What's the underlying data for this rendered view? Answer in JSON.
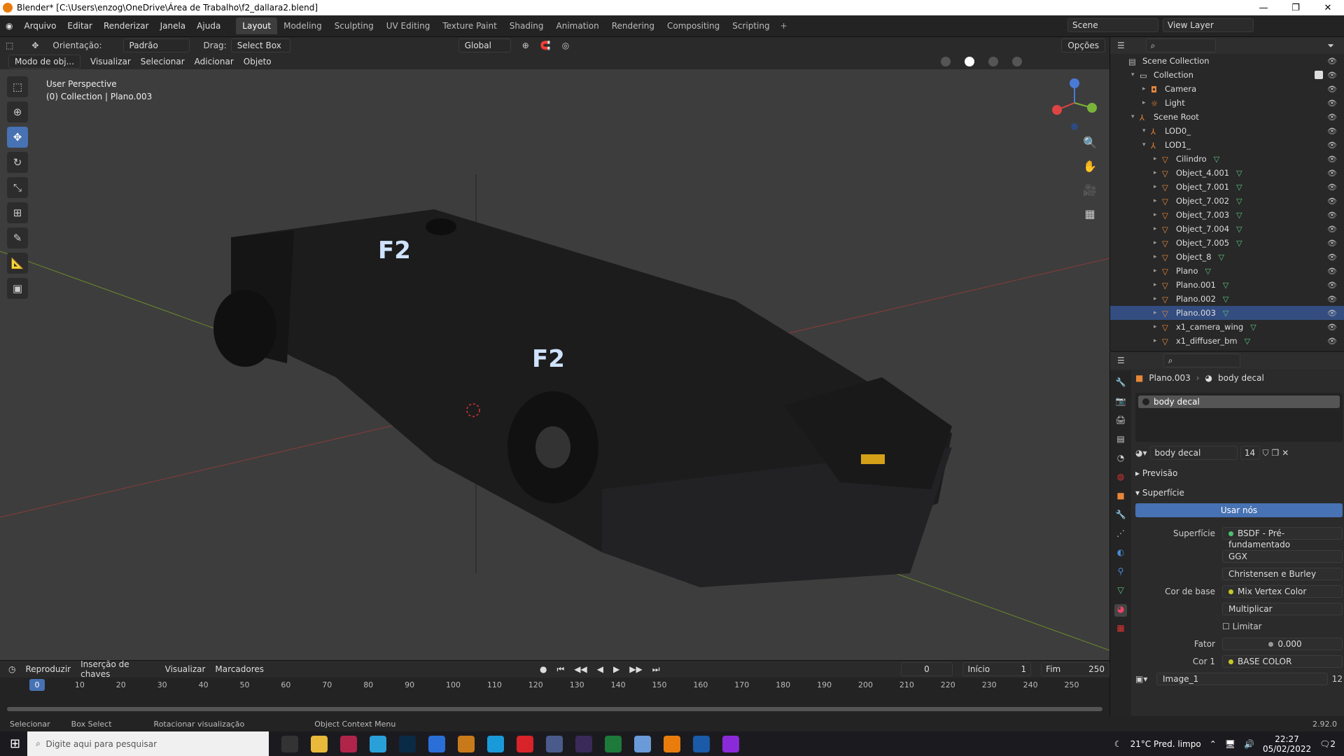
{
  "window": {
    "title": "Blender* [C:\\Users\\enzog\\OneDrive\\Área de Trabalho\\f2_dallara2.blend]"
  },
  "menu": [
    "Arquivo",
    "Editar",
    "Renderizar",
    "Janela",
    "Ajuda"
  ],
  "workspaces": [
    "Layout",
    "Modeling",
    "Sculpting",
    "UV Editing",
    "Texture Paint",
    "Shading",
    "Animation",
    "Rendering",
    "Compositing",
    "Scripting"
  ],
  "scene": {
    "name": "Scene",
    "view_layer": "View Layer"
  },
  "toolbar": {
    "orientation_label": "Orientação:",
    "orientation_value": "Padrão",
    "drag_label": "Drag:",
    "drag_value": "Select Box",
    "transform": "Global",
    "options": "Opções"
  },
  "view_header": {
    "mode": "Modo de obj...",
    "items": [
      "Visualizar",
      "Selecionar",
      "Adicionar",
      "Objeto"
    ]
  },
  "viewport": {
    "line1": "User Perspective",
    "line2": "(0) Collection | Plano.003"
  },
  "outliner": {
    "rows": [
      {
        "label": "Scene Collection",
        "indent": 0,
        "type": "scene"
      },
      {
        "label": "Collection",
        "indent": 1,
        "type": "collection"
      },
      {
        "label": "Camera",
        "indent": 2,
        "type": "camera"
      },
      {
        "label": "Light",
        "indent": 2,
        "type": "light"
      },
      {
        "label": "Scene Root",
        "indent": 1,
        "type": "empty"
      },
      {
        "label": "LOD0_",
        "indent": 2,
        "type": "empty"
      },
      {
        "label": "LOD1_",
        "indent": 2,
        "type": "empty"
      },
      {
        "label": "Cilindro",
        "indent": 3,
        "type": "mesh"
      },
      {
        "label": "Object_4.001",
        "indent": 3,
        "type": "mesh"
      },
      {
        "label": "Object_7.001",
        "indent": 3,
        "type": "mesh"
      },
      {
        "label": "Object_7.002",
        "indent": 3,
        "type": "mesh"
      },
      {
        "label": "Object_7.003",
        "indent": 3,
        "type": "mesh"
      },
      {
        "label": "Object_7.004",
        "indent": 3,
        "type": "mesh"
      },
      {
        "label": "Object_7.005",
        "indent": 3,
        "type": "mesh"
      },
      {
        "label": "Object_8",
        "indent": 3,
        "type": "mesh"
      },
      {
        "label": "Plano",
        "indent": 3,
        "type": "mesh"
      },
      {
        "label": "Plano.001",
        "indent": 3,
        "type": "mesh"
      },
      {
        "label": "Plano.002",
        "indent": 3,
        "type": "mesh"
      },
      {
        "label": "Plano.003",
        "indent": 3,
        "type": "mesh"
      },
      {
        "label": "x1_camera_wing",
        "indent": 3,
        "type": "mesh"
      },
      {
        "label": "x1_diffuser_bm",
        "indent": 3,
        "type": "mesh"
      }
    ]
  },
  "properties": {
    "object": "Plano.003",
    "material": "body decal",
    "slot": "body decal",
    "mat_name": "body decal",
    "users": "14",
    "preview": "Previsão",
    "surface_panel": "Superfície",
    "use_nodes": "Usar nós",
    "rows": [
      {
        "label": "Superfície",
        "value": "BSDF - Pré-fundamentado"
      },
      {
        "label": "",
        "value": "GGX"
      },
      {
        "label": "",
        "value": "Christensen e Burley"
      },
      {
        "label": "Cor de base",
        "value": "Mix Vertex Color"
      },
      {
        "label": "",
        "value": "Multiplicar"
      },
      {
        "label": "",
        "value": "Limitar"
      },
      {
        "label": "Fator",
        "value": "0.000"
      },
      {
        "label": "Cor 1",
        "value": "BASE COLOR"
      },
      {
        "label": "",
        "value": "Image_1"
      }
    ],
    "image_users": "12"
  },
  "timeline": {
    "menus": [
      "Reproduzir",
      "Inserção de chaves",
      "Visualizar",
      "Marcadores"
    ],
    "current": "0",
    "start_label": "Início",
    "start": "1",
    "end_label": "Fim",
    "end": "250",
    "ticks": [
      "0",
      "10",
      "20",
      "30",
      "40",
      "50",
      "60",
      "70",
      "80",
      "90",
      "100",
      "110",
      "120",
      "130",
      "140",
      "150",
      "160",
      "170",
      "180",
      "190",
      "200",
      "210",
      "220",
      "230",
      "240",
      "250"
    ]
  },
  "status": {
    "items": [
      "Selecionar",
      "Box Select",
      "Rotacionar visualização",
      "Object Context Menu"
    ],
    "version": "2.92.0"
  },
  "taskbar": {
    "search": "Digite aqui para pesquisar",
    "weather": "21°C  Pred. limpo",
    "time": "22:27",
    "date": "05/02/2022",
    "notif": "2"
  }
}
